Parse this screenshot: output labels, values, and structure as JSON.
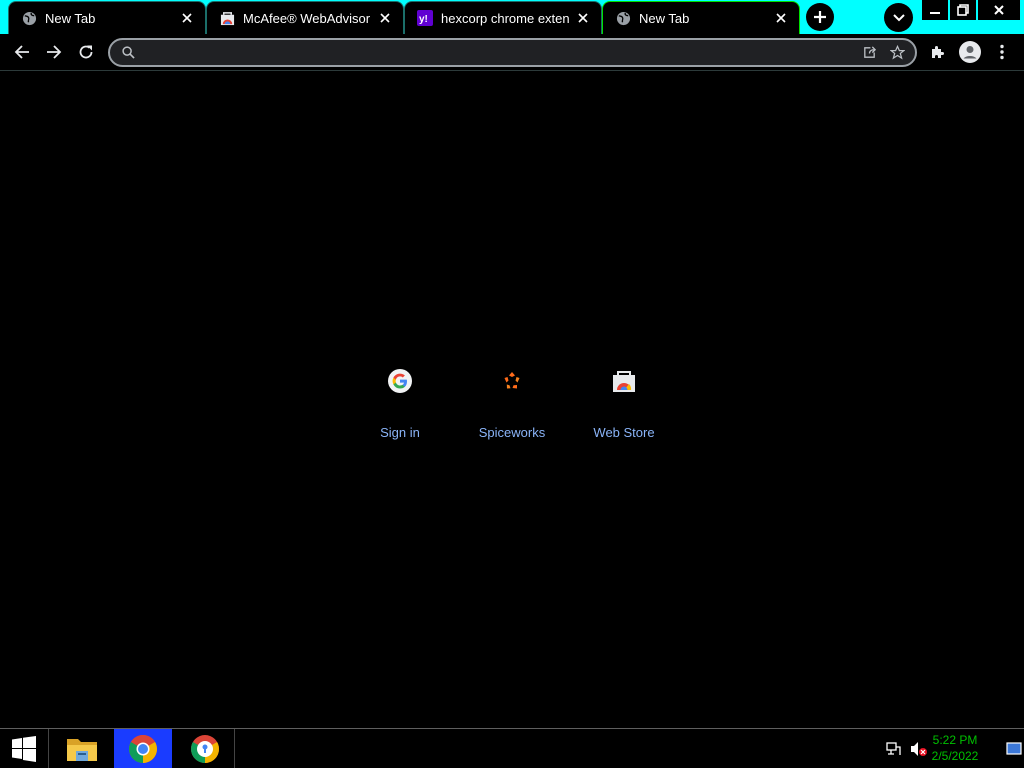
{
  "tabs": [
    {
      "title": "New Tab",
      "icon": "globe-icon",
      "active": false
    },
    {
      "title": "McAfee® WebAdvisor - Chrome Web Store",
      "icon": "webstore-icon",
      "active": false
    },
    {
      "title": "hexcorp chrome extention",
      "icon": "yahoo-icon",
      "active": false
    },
    {
      "title": "New Tab",
      "icon": "globe-icon",
      "active": true
    }
  ],
  "omnibox": {
    "value": "",
    "placeholder": ""
  },
  "shortcuts": [
    {
      "label": "Sign in",
      "icon": "google-icon"
    },
    {
      "label": "Spiceworks",
      "icon": "spiceworks-icon"
    },
    {
      "label": "Web Store",
      "icon": "webstore-icon"
    }
  ],
  "clock": {
    "time": "5:22 PM",
    "date": "2/5/2022"
  },
  "colors": {
    "tabstrip": "#00ffff",
    "shortcut_label": "#8ab4f8",
    "clock": "#00c000",
    "chrome_taskbar_active": "#1a3cff"
  }
}
